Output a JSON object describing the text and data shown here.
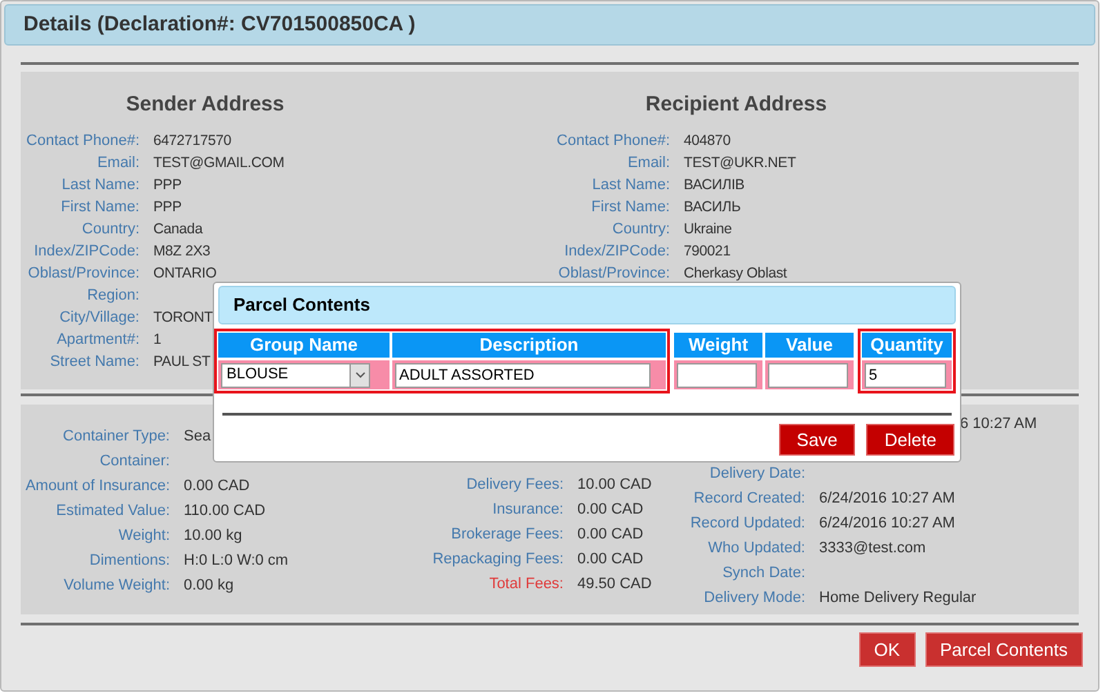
{
  "details_header": {
    "title": "Details (Declaration#: CV701500850CA )"
  },
  "sender": {
    "heading": "Sender Address",
    "fields": [
      {
        "label": "Contact Phone#:",
        "value": "6472717570"
      },
      {
        "label": "Email:",
        "value": "TEST@GMAIL.COM"
      },
      {
        "label": "Last Name:",
        "value": "PPP"
      },
      {
        "label": "First Name:",
        "value": "PPP"
      },
      {
        "label": "Country:",
        "value": "Canada"
      },
      {
        "label": "Index/ZIPCode:",
        "value": "M8Z 2X3"
      },
      {
        "label": "Oblast/Province:",
        "value": "ONTARIO"
      },
      {
        "label": "Region:"
      },
      {
        "label": "City/Village:",
        "value": "TORONT"
      },
      {
        "label": "Apartment#:",
        "value": "1"
      },
      {
        "label": "Street Name:",
        "value": "PAUL ST"
      }
    ]
  },
  "recipient": {
    "heading": "Recipient Address",
    "fields": [
      {
        "label": "Contact Phone#:",
        "value": "404870"
      },
      {
        "label": "Email:",
        "value": "TEST@UKR.NET"
      },
      {
        "label": "Last Name:",
        "value": "ВАСИЛІВ"
      },
      {
        "label": "First Name:",
        "value": "ВАСИЛЬ"
      },
      {
        "label": "Country:",
        "value": "Ukraine"
      },
      {
        "label": "Index/ZIPCode:",
        "value": "790021"
      },
      {
        "label": "Oblast/Province:",
        "value": "Cherkasy Oblast"
      }
    ]
  },
  "shipment": {
    "columns": [
      {
        "fields": [
          {
            "kind": "plain",
            "label": "Container Type:",
            "value": "Sea"
          },
          {
            "kind": "plain",
            "label": "Container:"
          },
          {
            "kind": "plain",
            "label": "Amount of Insurance:",
            "value": "0.00 CAD"
          },
          {
            "kind": "plain",
            "label": "Estimated Value:",
            "value": "110.00 CAD"
          },
          {
            "kind": "plain",
            "label": "Weight:",
            "value": "10.00 kg"
          },
          {
            "kind": "plain",
            "label": "Dimentions:",
            "value": "H:0 L:0 W:0 cm"
          },
          {
            "kind": "plain",
            "label": "Volume Weight:",
            "value": "0.00 kg"
          }
        ]
      },
      {
        "fields": [
          {
            "kind": "plain",
            "label": "Delivery Fees:",
            "value": "10.00 CAD"
          },
          {
            "kind": "plain",
            "label": "Insurance:",
            "value": "0.00 CAD"
          },
          {
            "kind": "plain",
            "label": "Brokerage Fees:",
            "value": "0.00 CAD"
          },
          {
            "kind": "plain",
            "label": "Repackaging Fees:",
            "value": "0.00 CAD"
          },
          {
            "kind": "total",
            "label": "Total Fees:",
            "value": "49.50 CAD"
          }
        ]
      },
      {
        "fields": [
          {
            "kind": "clipped",
            "value": "6 10:27 AM"
          },
          {
            "kind": "plain",
            "label": "Delivery Date:"
          },
          {
            "kind": "plain",
            "label": "Record Created:",
            "value": "6/24/2016 10:27 AM"
          },
          {
            "kind": "plain",
            "label": "Record Updated:",
            "value": "6/24/2016 10:27 AM"
          },
          {
            "kind": "plain",
            "label": "Who Updated:",
            "value": "3333@test.com"
          },
          {
            "kind": "plain",
            "label": "Synch Date:"
          },
          {
            "kind": "plain",
            "label": "Delivery Mode:",
            "value": "Home Delivery Regular"
          }
        ]
      }
    ]
  },
  "buttons": [
    {
      "label": "OK"
    },
    {
      "label": "Parcel Contents"
    }
  ],
  "parcel_contents": {
    "title": "Parcel Contents",
    "columns": [
      {
        "heading": "Group Name",
        "highlighted": true,
        "cell": {
          "kind": "select",
          "value": "BLOUSE"
        }
      },
      {
        "heading": "Description",
        "highlighted": true,
        "cell": {
          "kind": "text",
          "value": "ADULT ASSORTED"
        }
      },
      {
        "heading": "Weight",
        "highlighted": false,
        "cell": {
          "kind": "text"
        }
      },
      {
        "heading": "Value",
        "highlighted": false,
        "cell": {
          "kind": "text"
        }
      },
      {
        "heading": "Quantity",
        "highlighted": true,
        "cell": {
          "kind": "text",
          "value": "5"
        }
      }
    ],
    "buttons": [
      {
        "label": "Save"
      },
      {
        "label": "Delete"
      }
    ]
  }
}
